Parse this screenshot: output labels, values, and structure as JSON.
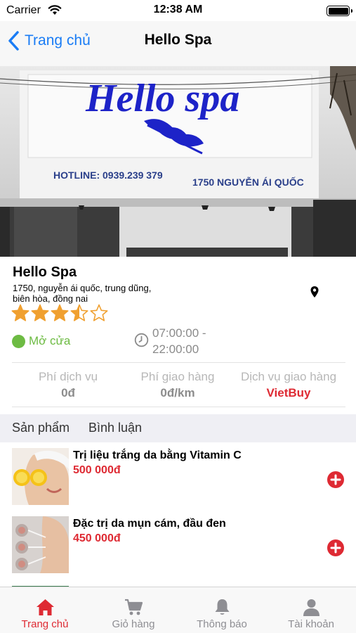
{
  "status_bar": {
    "carrier": "Carrier",
    "time": "12:38 AM"
  },
  "nav": {
    "back_label": "Trang chủ",
    "title": "Hello Spa"
  },
  "hero": {
    "sign_text": "Hello spa",
    "hotline": "HOTLINE: 0939.239 379",
    "sign_address": "1750 NGUYỄN ÁI QUỐC"
  },
  "shop": {
    "name": "Hello Spa",
    "address_line1": "1750, nguyễn ái quốc, trung dũng,",
    "address_line2": "biên hòa, đồng nai",
    "rating": 3.5,
    "rating_max": 5,
    "open_status": "Mở cửa",
    "hours_line1": "07:00:00 -",
    "hours_line2": "22:00:00"
  },
  "stats": [
    {
      "label": "Phí dịch vụ",
      "value": "0đ"
    },
    {
      "label": "Phí giao hàng",
      "value": "0đ/km"
    },
    {
      "label": "Dịch vụ giao hàng",
      "value": "VietBuy"
    }
  ],
  "segments": [
    "Sản phẩm",
    "Bình luận"
  ],
  "products": [
    {
      "name": "Trị liệu trắng da bằng Vitamin C",
      "price": "500 000đ"
    },
    {
      "name": "Đặc trị da mụn cám, đầu đen",
      "price": "450 000đ"
    }
  ],
  "tabs": [
    {
      "label": "Trang chủ",
      "icon": "home-icon",
      "active": true
    },
    {
      "label": "Giỏ hàng",
      "icon": "cart-icon",
      "active": false
    },
    {
      "label": "Thông báo",
      "icon": "bell-icon",
      "active": false
    },
    {
      "label": "Tài khoản",
      "icon": "person-icon",
      "active": false
    }
  ],
  "colors": {
    "accent_blue": "#1a7cf5",
    "accent_red": "#de2a33",
    "open_green": "#6dbb43",
    "star_orange": "#f0a030"
  }
}
